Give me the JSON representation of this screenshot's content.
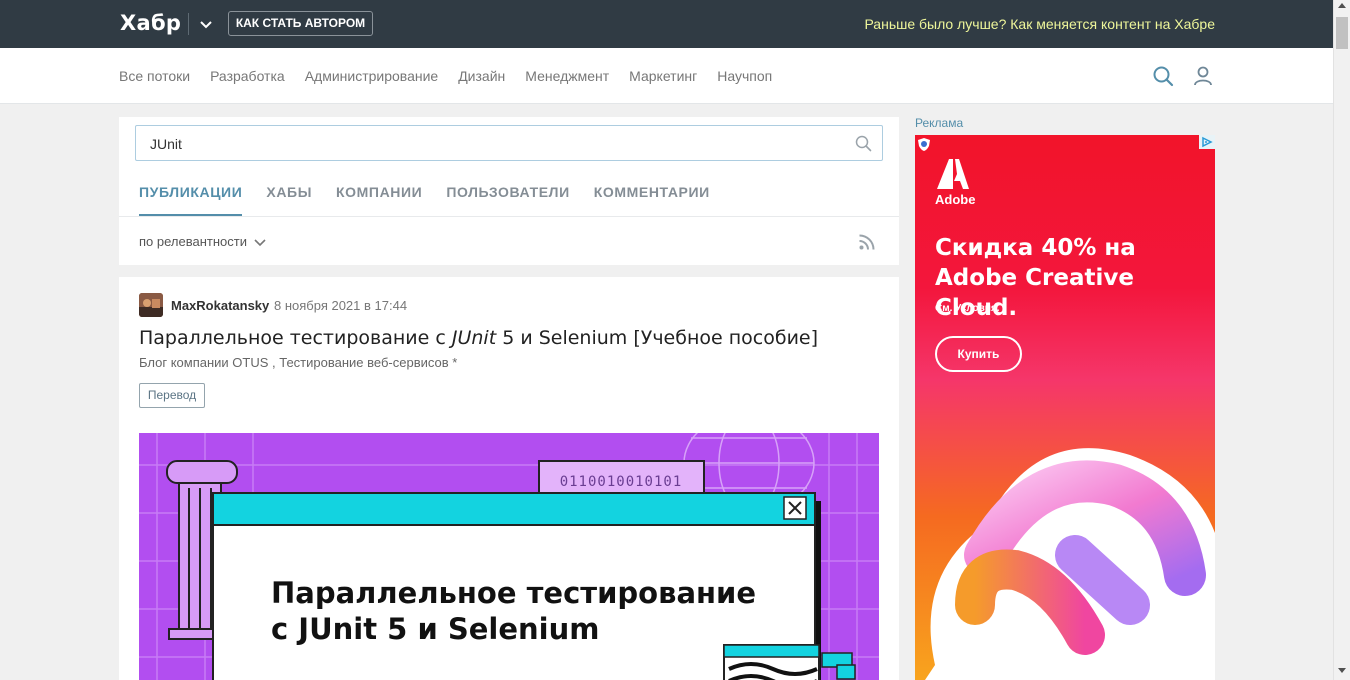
{
  "topbar": {
    "logo": "Хабр",
    "author_button": "КАК СТАТЬ АВТОРОМ",
    "promo": "Раньше было лучше? Как меняется контент на Хабре"
  },
  "nav": {
    "items": [
      "Все потоки",
      "Разработка",
      "Администрирование",
      "Дизайн",
      "Менеджмент",
      "Маркетинг",
      "Научпоп"
    ]
  },
  "search": {
    "value": "JUnit",
    "tabs": [
      "ПУБЛИКАЦИИ",
      "ХАБЫ",
      "КОМПАНИИ",
      "ПОЛЬЗОВАТЕЛИ",
      "КОММЕНТАРИИ"
    ],
    "active_tab": "ПУБЛИКАЦИИ",
    "sort": "по релевантности"
  },
  "article": {
    "author": "MaxRokatansky",
    "date": "8 ноября 2021 в 17:44",
    "title_before": "Параллельное тестирование с ",
    "title_em": "JUnit",
    "title_after": " 5 и Selenium [Учебное пособие]",
    "hubs": "Блог компании OTUS , Тестирование веб-сервисов *",
    "tag": "Перевод",
    "cover": {
      "binary": "0110010010101",
      "headline_line1": "Параллельное тестирование",
      "headline_line2": "с JUnit 5 и Selenium"
    }
  },
  "ad": {
    "label": "Реклама",
    "brand": "Adobe",
    "headline": "Скидка 40% на Adobe Creative Cloud.",
    "terms": "См. Условия.",
    "button": "Купить"
  },
  "colors": {
    "topbar": "#303b44",
    "accent": "#548eaa",
    "promo": "#eef69a",
    "cover_bg": "#b24ef0",
    "cover_window": "#13d3e0"
  }
}
